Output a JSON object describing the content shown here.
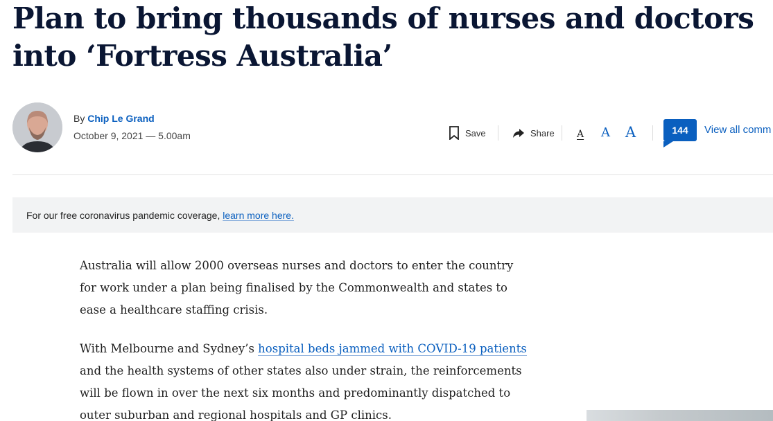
{
  "article": {
    "headline": "Plan to bring thousands of nurses and doctors into ‘Fortress Australia’",
    "byline": {
      "by": "By",
      "author": "Chip Le Grand",
      "date": "October 9, 2021 — 5.00am"
    }
  },
  "toolbar": {
    "save_label": "Save",
    "share_label": "Share",
    "font_small": "A",
    "font_medium": "A",
    "font_large": "A",
    "comment_count": "144",
    "view_comments": "View all comm"
  },
  "notice": {
    "text": "For our free coronavirus pandemic coverage, ",
    "link": "learn more here."
  },
  "body": {
    "p1": "Australia will allow 2000 overseas nurses and doctors to enter the country for work under a plan being finalised by the Commonwealth and states to ease a healthcare staffing crisis.",
    "p2_start": "With Melbourne and Sydney’s ",
    "p2_link": "hospital beds jammed with COVID-19 patients",
    "p2_end": " and the health systems of other states also under strain, the reinforcements will be flown in over the next six months and predominantly dispatched to outer suburban and regional hospitals and GP clinics."
  },
  "colors": {
    "headline": "#0a1633",
    "accent": "#0a5fbf",
    "notice_bg": "#f2f3f4"
  },
  "icons": {
    "save": "bookmark-icon",
    "share": "share-arrow-icon"
  }
}
